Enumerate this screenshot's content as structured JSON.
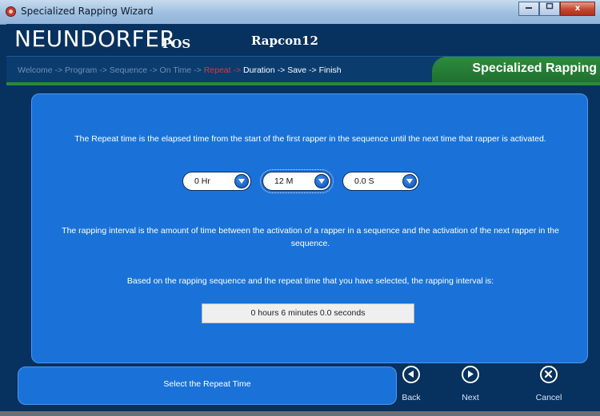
{
  "window": {
    "title": "Specialized Rapping Wizard",
    "buttons": [
      "minimize",
      "maximize",
      "close"
    ],
    "close_label": "x"
  },
  "header": {
    "brand": "NEUNDORFER",
    "brand_sub": "POS",
    "model": "Rapcon12"
  },
  "breadcrumb": {
    "steps": [
      {
        "label": "Welcome",
        "state": "done"
      },
      {
        "label": "Program",
        "state": "done"
      },
      {
        "label": "Sequence",
        "state": "done"
      },
      {
        "label": "On Time",
        "state": "done"
      },
      {
        "label": "Repeat",
        "state": "current"
      },
      {
        "label": "Duration",
        "state": "upcoming"
      },
      {
        "label": "Save",
        "state": "upcoming"
      },
      {
        "label": "Finish",
        "state": "upcoming"
      }
    ],
    "separator": " -> ",
    "phase_title": "Specialized Rapping"
  },
  "main": {
    "repeat_description": "The Repeat time is the elapsed time from the start of the first rapper in the sequence until the next time that rapper is activated.",
    "hours_value": "0 Hr",
    "minutes_value": "12 M",
    "seconds_value": "0.0 S",
    "interval_description": "The rapping interval is the amount of time between the activation of a rapper in a sequence and the activation of the next rapper in the sequence.",
    "result_intro": "Based on the rapping sequence and the repeat time that you have selected, the rapping interval is:",
    "result_value": "0 hours 6 minutes 0.0 seconds"
  },
  "footer": {
    "status_text": "Select the Repeat Time",
    "back_label": "Back",
    "next_label": "Next",
    "cancel_label": "Cancel"
  },
  "colors": {
    "panel_blue": "#1a72d8",
    "background_navy": "#07315f",
    "phase_green": "#2a8a3a",
    "current_step_red": "#e3343a"
  }
}
